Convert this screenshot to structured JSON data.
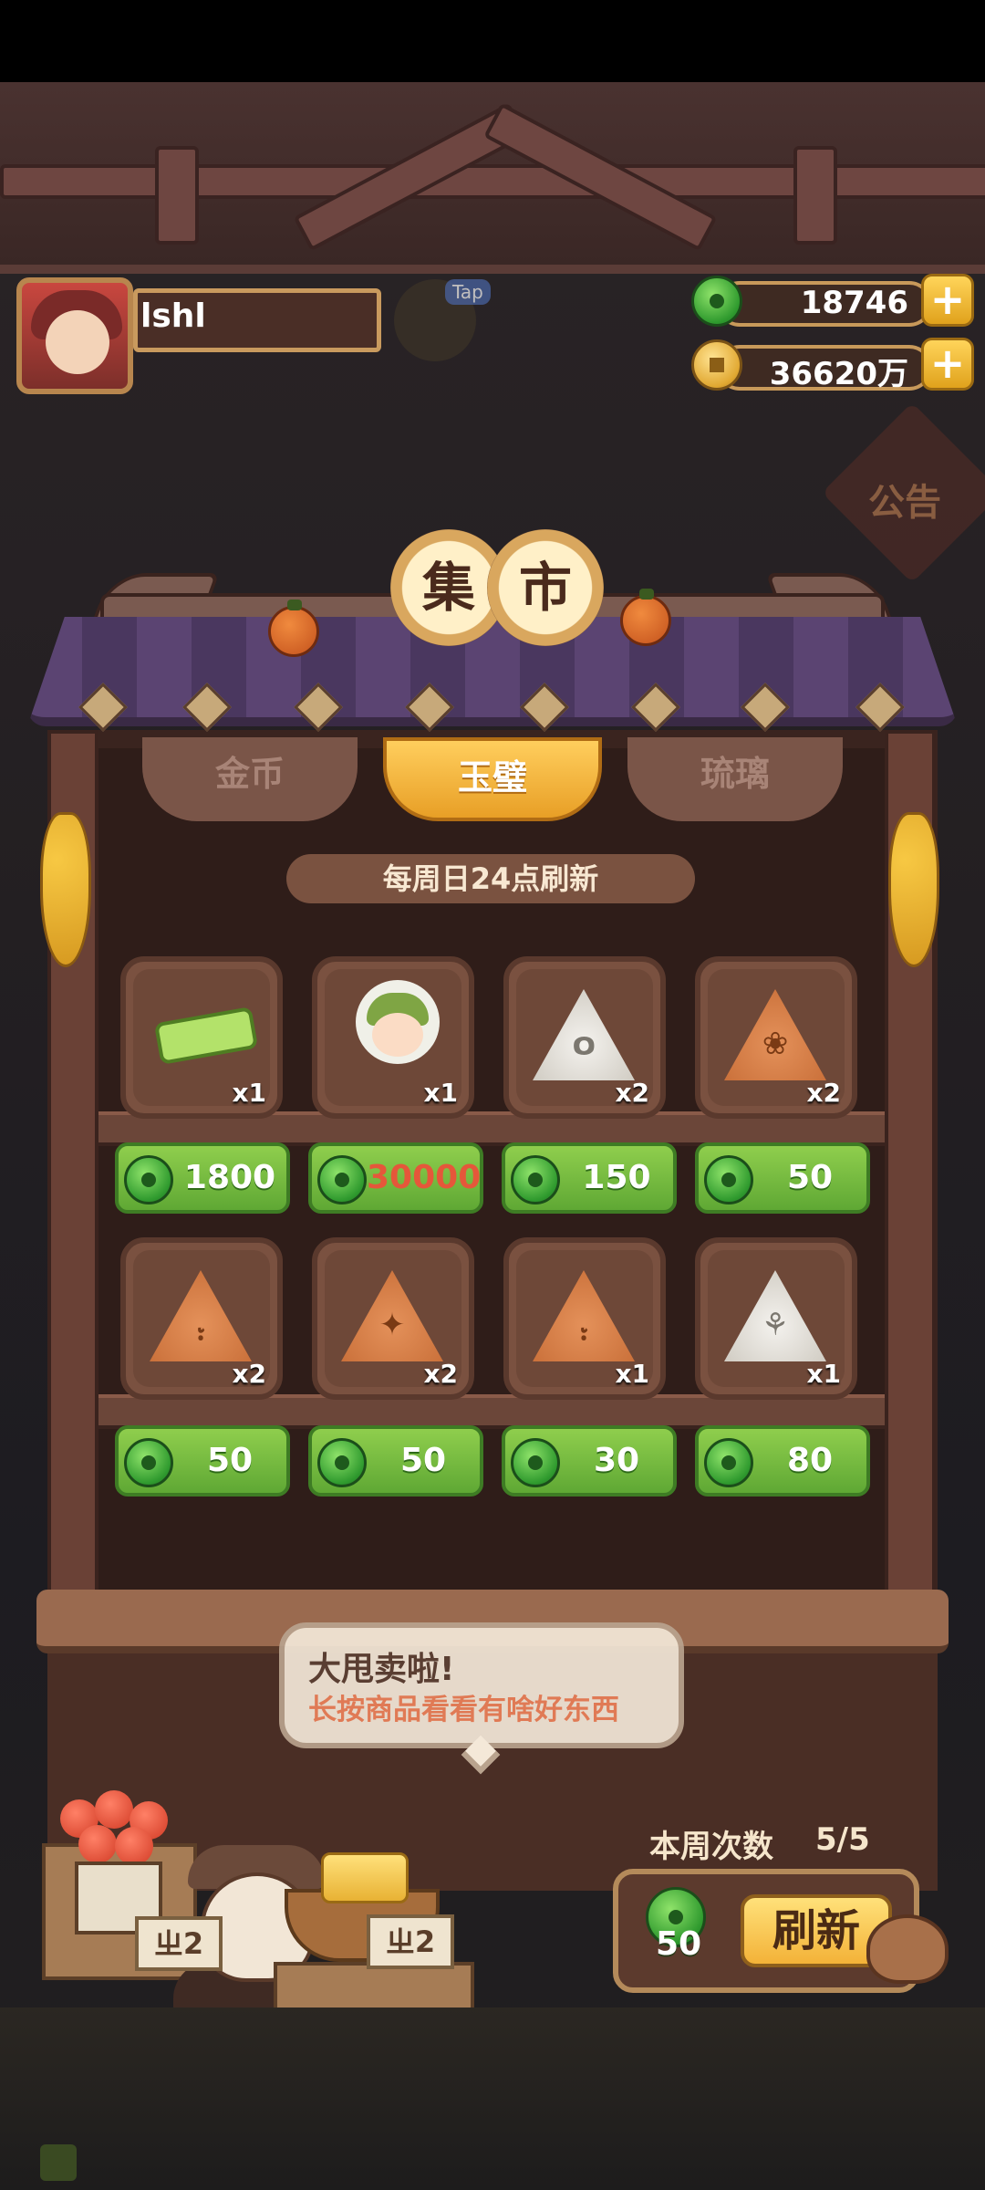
{
  "player": {
    "name": "lshl",
    "tap_tag": "Tap"
  },
  "currencies": {
    "jade": {
      "value": "18746",
      "icon": "jade-coin-icon"
    },
    "gold": {
      "value": "36620万",
      "icon": "gold-coin-icon"
    },
    "plus_label": "+"
  },
  "notice_label": "公告",
  "shop": {
    "title_chars": [
      "集",
      "市"
    ],
    "tabs": [
      {
        "label": "金币",
        "active": false
      },
      {
        "label": "玉璧",
        "active": true
      },
      {
        "label": "琉璃",
        "active": false
      }
    ],
    "refresh_note": "每周日24点刷新",
    "items": [
      {
        "icon": "green-coupon-icon",
        "qty": "x1",
        "price": "1800",
        "price_color": "#ffffff"
      },
      {
        "icon": "girl-character-icon",
        "qty": "x1",
        "price": "30000",
        "price_color": "#e5573a"
      },
      {
        "icon": "white-rune-stone-icon",
        "qty": "x2",
        "price": "150",
        "price_color": "#ffffff"
      },
      {
        "icon": "orange-rune-stone-icon",
        "qty": "x2",
        "price": "50",
        "price_color": "#ffffff"
      },
      {
        "icon": "orange-rune-stone-icon",
        "qty": "x2",
        "price": "50",
        "price_color": "#ffffff"
      },
      {
        "icon": "orange-rune-stone-icon",
        "qty": "x2",
        "price": "50",
        "price_color": "#ffffff"
      },
      {
        "icon": "orange-rune-stone-icon",
        "qty": "x1",
        "price": "30",
        "price_color": "#ffffff"
      },
      {
        "icon": "white-rune-stone-icon",
        "qty": "x1",
        "price": "80",
        "price_color": "#ffffff"
      }
    ]
  },
  "speech": {
    "title": "大甩卖啦!",
    "subtitle": "长按商品看看有啥好东西"
  },
  "stall_tags": [
    "ㄓ2",
    "ㄓ2"
  ],
  "refresh": {
    "week_label": "本周次数",
    "week_count": "5/5",
    "cost": "50",
    "button_label": "刷新"
  },
  "colors": {
    "accent_gold": "#f3b238",
    "price_green": "#6fb63c",
    "wood_dark": "#3a241f"
  }
}
